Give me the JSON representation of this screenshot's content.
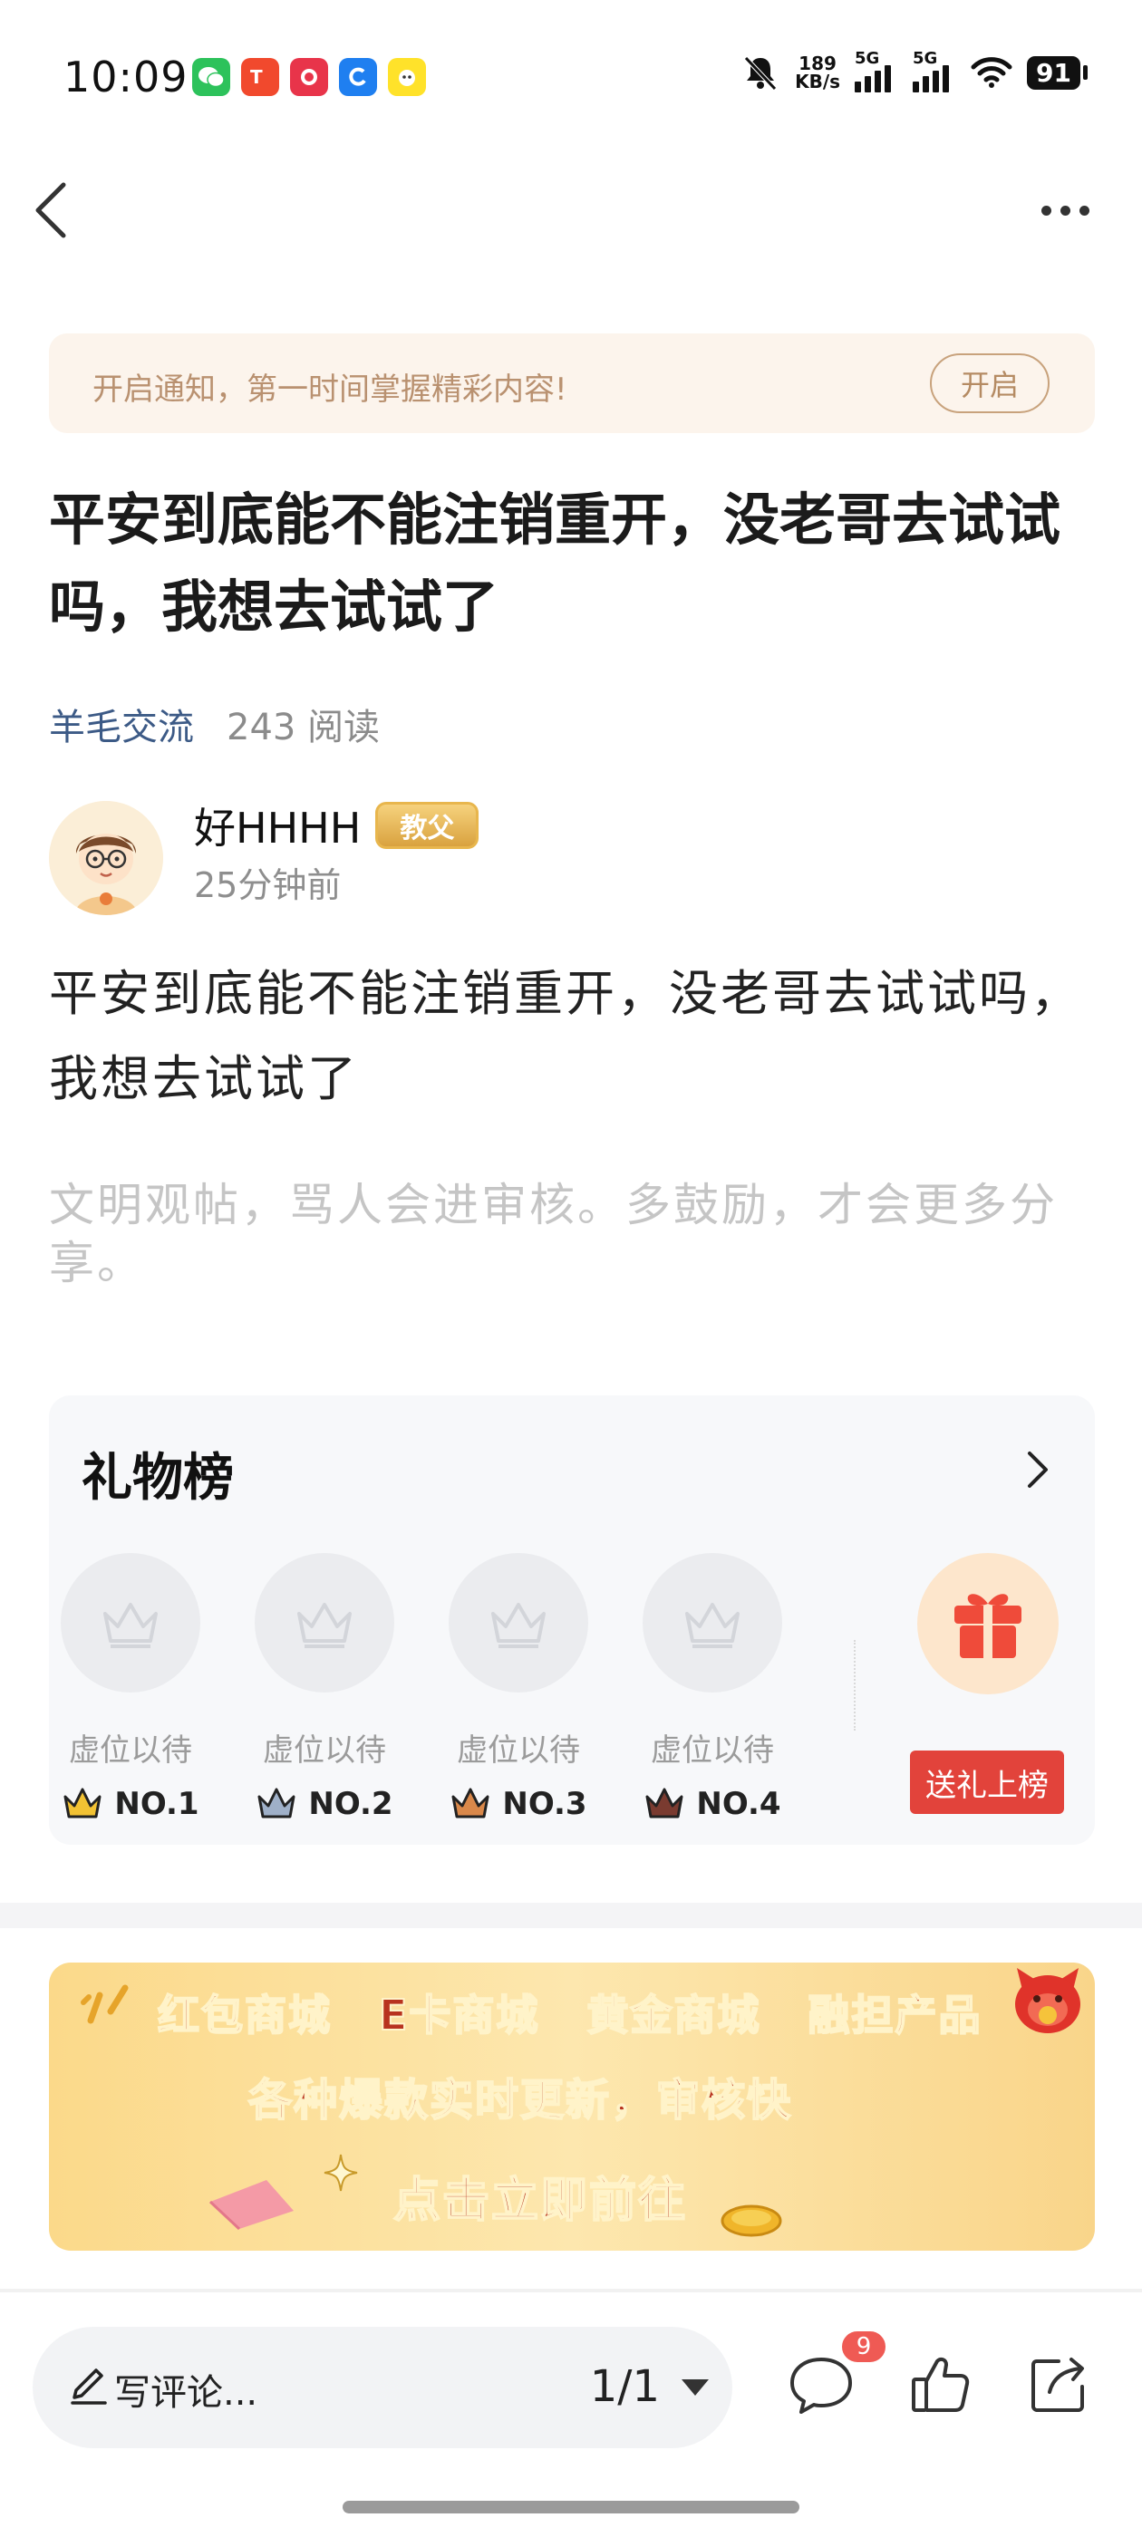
{
  "status_bar": {
    "time": "10:09",
    "net_speed_value": "189",
    "net_speed_unit": "KB/s",
    "sim1": "5G",
    "sim2": "5G",
    "battery": "91",
    "app_icons": [
      "wechat-icon",
      "taobao-icon",
      "red-app-icon",
      "blue-app-icon",
      "yellow-app-icon"
    ]
  },
  "notify": {
    "text": "开启通知，第一时间掌握精彩内容!",
    "button": "开启"
  },
  "post": {
    "title": "平安到底能不能注销重开，没老哥去试试吗，我想去试试了",
    "category": "羊毛交流",
    "reads": "243 阅读",
    "author": "好HHHH",
    "badge": "教父",
    "time": "25分钟前",
    "content": "平安到底能不能注销重开，没老哥去试试吗，我想去试试了",
    "hint": "文明观帖，骂人会进审核。多鼓励，才会更多分享。"
  },
  "gift_list": {
    "title": "礼物榜",
    "slots": [
      {
        "label": "虚位以待",
        "rank": "NO.1",
        "crown_color": "#f2c233"
      },
      {
        "label": "虚位以待",
        "rank": "NO.2",
        "crown_color": "#9fb0c8"
      },
      {
        "label": "虚位以待",
        "rank": "NO.3",
        "crown_color": "#d9884a"
      },
      {
        "label": "虚位以待",
        "rank": "NO.4",
        "crown_color": "#7a3b30"
      }
    ],
    "send_button": "送礼上榜"
  },
  "banner": {
    "row1": [
      "红包商城",
      "E卡商城",
      "黄金商城",
      "融担产品"
    ],
    "row2": "各种爆款实时更新，审核快",
    "row3": "点击立即前往"
  },
  "bottom_bar": {
    "comment_placeholder": "写评论...",
    "page_indicator": "1/1",
    "comment_count": "9"
  },
  "colors": {
    "accent_red": "#e2433b",
    "category_blue": "#3c5a86",
    "notify_bg": "#fcf4ec"
  }
}
